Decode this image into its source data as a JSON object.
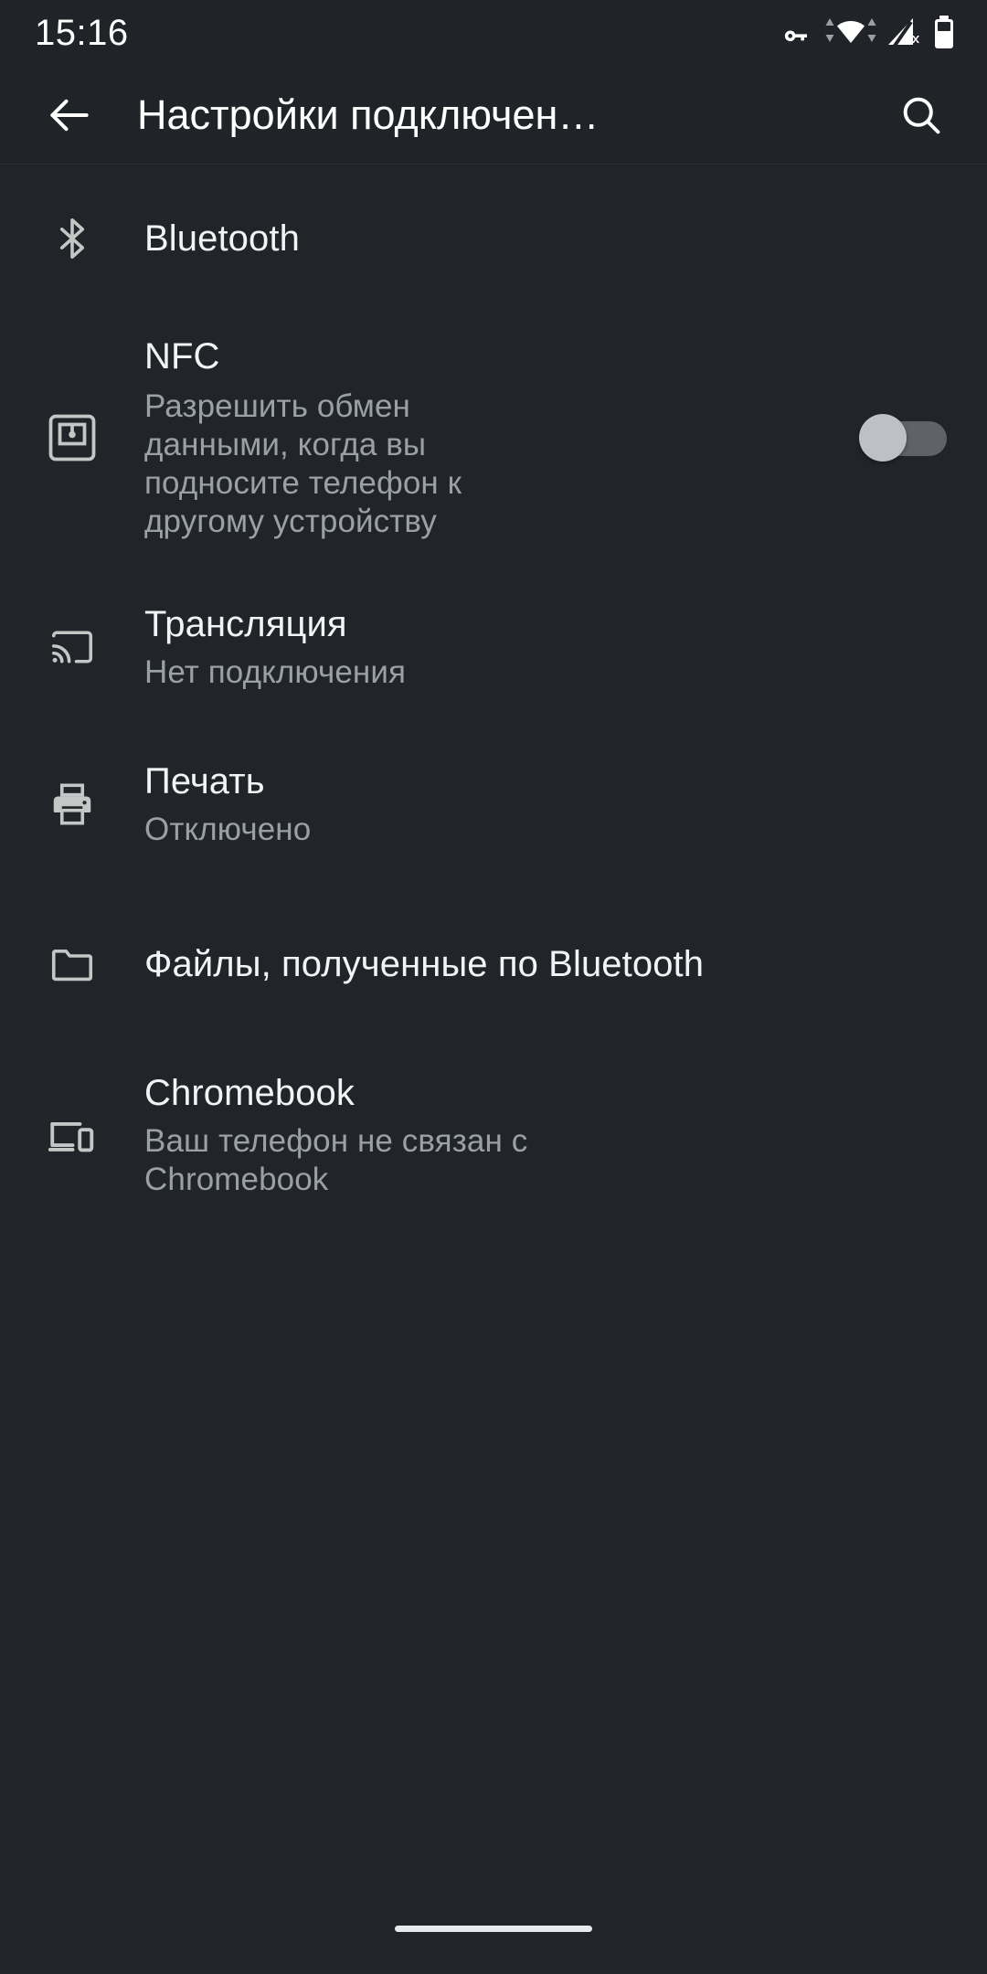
{
  "status_bar": {
    "clock": "15:16",
    "icons": [
      {
        "name": "vpn-key-icon",
        "label": "VPN"
      },
      {
        "name": "wifi-data-transfer-icon",
        "label": "Wi-Fi"
      },
      {
        "name": "cellular-no-signal-icon",
        "label": "No SIM"
      },
      {
        "name": "battery-icon",
        "label": "Battery"
      }
    ]
  },
  "app_bar": {
    "back_label": "Назад",
    "title": "Настройки подключен…",
    "search_label": "Поиск"
  },
  "colors": {
    "background": "#212529",
    "status_background": "#202429",
    "title_text": "#ffffff",
    "primary_text": "#f1f3f4",
    "secondary_text": "#9aa0a6",
    "icon": "#c4c7c5",
    "toggle_track_off": "#5f6368",
    "toggle_thumb_off": "#bdc1c6",
    "nav_pill": "#e8eaed"
  },
  "settings": [
    {
      "key": "bluetooth",
      "icon": "bluetooth-icon",
      "title": "Bluetooth",
      "subtitle_lines": []
    },
    {
      "key": "nfc",
      "icon": "nfc-icon",
      "title": "NFC",
      "subtitle_lines": [
        "Разрешить обмен",
        "данными, когда вы",
        "подносите телефон к",
        "другому устройству"
      ],
      "toggle": {
        "name": "nfc-toggle",
        "state": "off",
        "state_label": "Выключено"
      }
    },
    {
      "key": "cast",
      "icon": "cast-icon",
      "title": "Трансляция",
      "subtitle_lines": [
        "Нет подключения"
      ]
    },
    {
      "key": "print",
      "icon": "printer-icon",
      "title": "Печать",
      "subtitle_lines": [
        "Отключено"
      ]
    },
    {
      "key": "bluetooth-files",
      "icon": "folder-icon",
      "title": "Файлы, полученные по Bluetooth",
      "subtitle_lines": []
    },
    {
      "key": "chromebook",
      "icon": "laptop-phone-icon",
      "title": "Chromebook",
      "subtitle_lines": [
        "Ваш телефон не связан с",
        "Chromebook"
      ]
    }
  ],
  "nav_bar": {
    "home_pill_label": "Главный экран"
  }
}
